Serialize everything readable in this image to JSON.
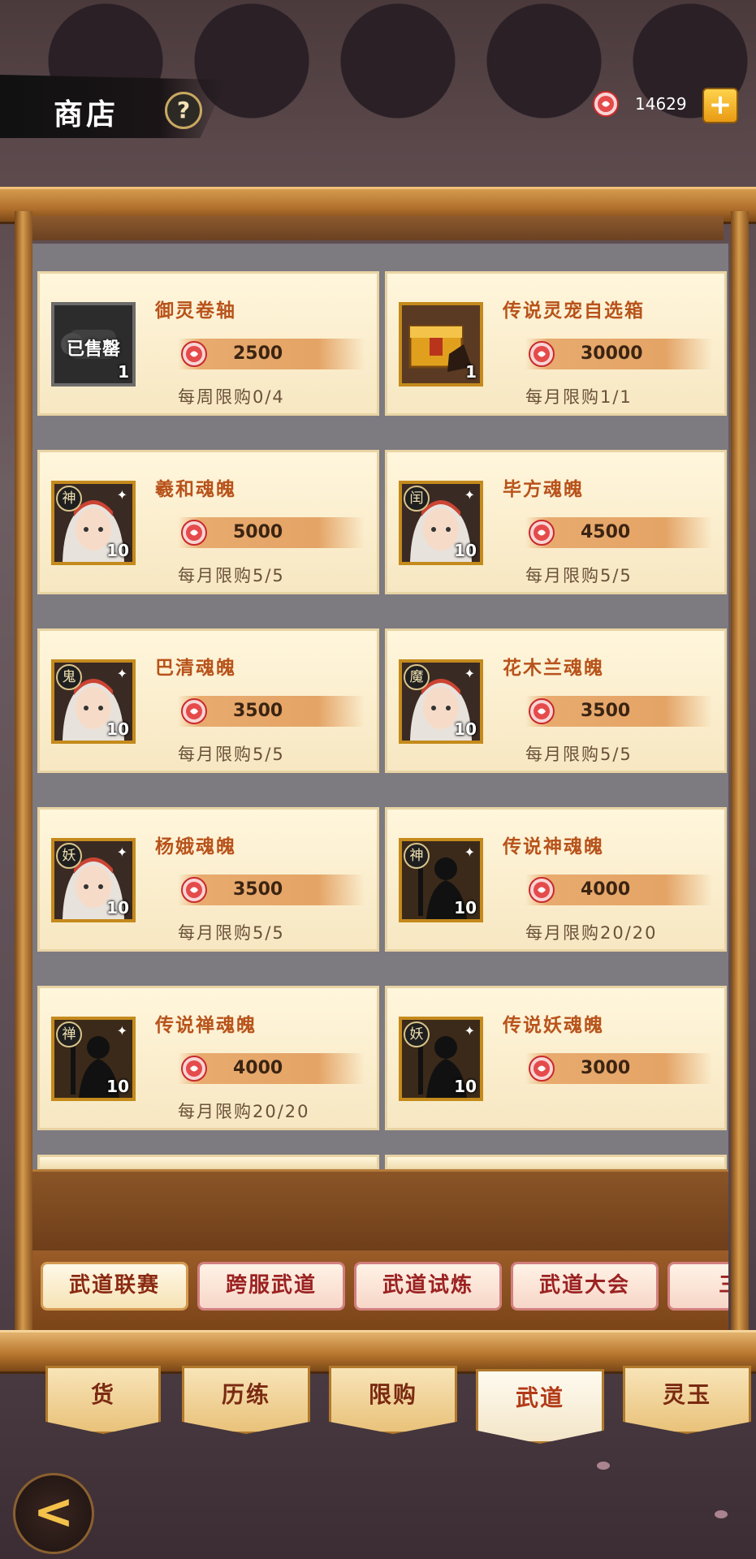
{
  "header": {
    "title": "商店",
    "help": "?",
    "currency_amount": "14629",
    "plus": "+"
  },
  "colors": {
    "accent": "#b8531b",
    "gold": "#c48a1c",
    "coin": "#e54b4b"
  },
  "items": [
    {
      "name": "御灵卷轴",
      "price": "2500",
      "limit": "每周限购0/4",
      "qty": "1",
      "sold_label": "已售罄",
      "faction": "",
      "icon": "scroll-icon"
    },
    {
      "name": "传说灵宠自选箱",
      "price": "30000",
      "limit": "每月限购1/1",
      "qty": "1",
      "faction": "",
      "icon": "chest-icon"
    },
    {
      "name": "羲和魂魄",
      "price": "5000",
      "limit": "每月限购5/5",
      "qty": "10",
      "faction": "神",
      "icon": "hero-portrait-icon"
    },
    {
      "name": "毕方魂魄",
      "price": "4500",
      "limit": "每月限购5/5",
      "qty": "10",
      "faction": "闰",
      "icon": "hero-portrait-icon"
    },
    {
      "name": "巴清魂魄",
      "price": "3500",
      "limit": "每月限购5/5",
      "qty": "10",
      "faction": "鬼",
      "icon": "hero-portrait-icon"
    },
    {
      "name": "花木兰魂魄",
      "price": "3500",
      "limit": "每月限购5/5",
      "qty": "10",
      "faction": "魔",
      "icon": "hero-portrait-icon"
    },
    {
      "name": "杨娥魂魄",
      "price": "3500",
      "limit": "每月限购5/5",
      "qty": "10",
      "faction": "妖",
      "icon": "hero-portrait-icon"
    },
    {
      "name": "传说神魂魄",
      "price": "4000",
      "limit": "每月限购20/20",
      "qty": "10",
      "faction": "神",
      "icon": "silhouette-icon"
    },
    {
      "name": "传说禅魂魄",
      "price": "4000",
      "limit": "每月限购20/20",
      "qty": "10",
      "faction": "禅",
      "icon": "silhouette-icon"
    },
    {
      "name": "传说妖魂魄",
      "price": "3000",
      "limit": "",
      "qty": "10",
      "faction": "妖",
      "icon": "silhouette-icon"
    }
  ],
  "subtabs": [
    "武道联赛",
    "跨服武道",
    "武道试炼",
    "武道大会",
    "三场"
  ],
  "maintabs": [
    "货",
    "历练",
    "限购",
    "武道",
    "灵玉"
  ],
  "maintab_active": "武道",
  "back": "<"
}
